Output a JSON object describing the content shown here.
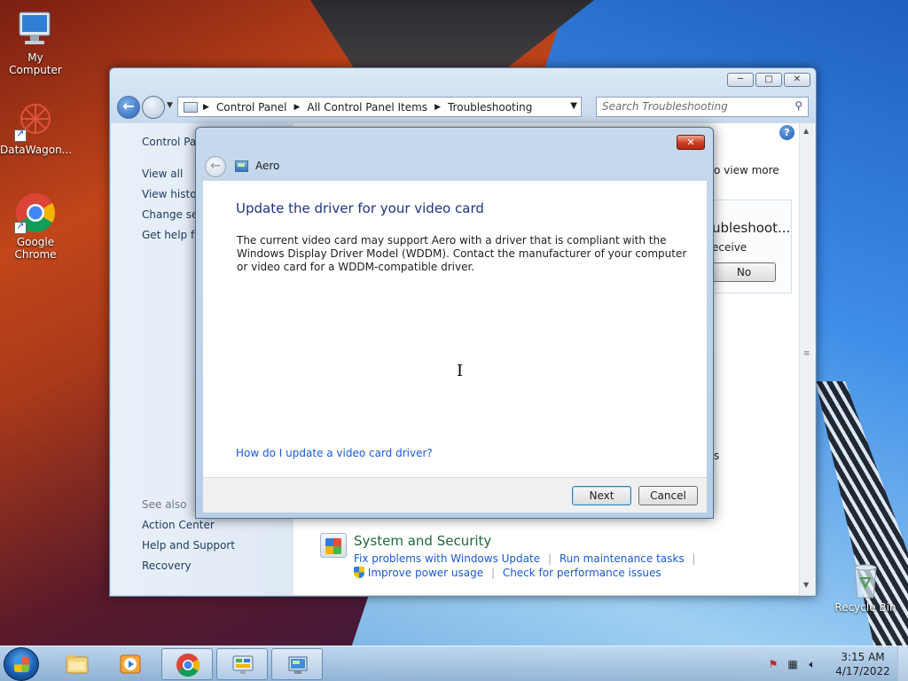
{
  "desktop": {
    "icons": [
      {
        "label": "My Computer",
        "icon": "computer-icon"
      },
      {
        "label": "DataWagon...",
        "icon": "datawagon-icon"
      },
      {
        "label": "Google Chrome",
        "icon": "chrome-icon"
      },
      {
        "label": "Recycle Bin",
        "icon": "recycle-bin-icon"
      }
    ]
  },
  "explorer": {
    "window_buttons": {
      "minimize": "─",
      "maximize": "□",
      "close": "✕"
    },
    "address": {
      "crumbs": [
        "Control Panel",
        "All Control Panel Items",
        "Troubleshooting"
      ]
    },
    "search": {
      "placeholder": "Search Troubleshooting"
    },
    "left_pane": {
      "home": "Control Pan",
      "links": [
        "View all",
        "View history",
        "Change sett",
        "Get help fro"
      ],
      "see_also_label": "See also",
      "see_also": [
        "Action Center",
        "Help and Support",
        "Recovery"
      ]
    },
    "content": {
      "view_more": "o view more",
      "troubleshoot_title": "ubleshoot...",
      "receive": "eceive",
      "no_button": "No",
      "stray_s": "s",
      "section_title": "System and Security",
      "links_row1": [
        "Fix problems with Windows Update",
        "Run maintenance tasks"
      ],
      "links_row2": [
        "Improve power usage",
        "Check for performance issues"
      ]
    }
  },
  "dialog": {
    "close": "✕",
    "title": "Aero",
    "heading": "Update the driver for your video card",
    "body": "The current video card may support Aero with a driver that is compliant with the Windows Display Driver Model (WDDM).  Contact the manufacturer of your computer or video card for a WDDM-compatible driver.",
    "help_link": "How do I update a video card driver?",
    "next_button": "Next",
    "cancel_button": "Cancel"
  },
  "taskbar": {
    "clock_time": "3:15 AM",
    "clock_date": "4/17/2022"
  }
}
